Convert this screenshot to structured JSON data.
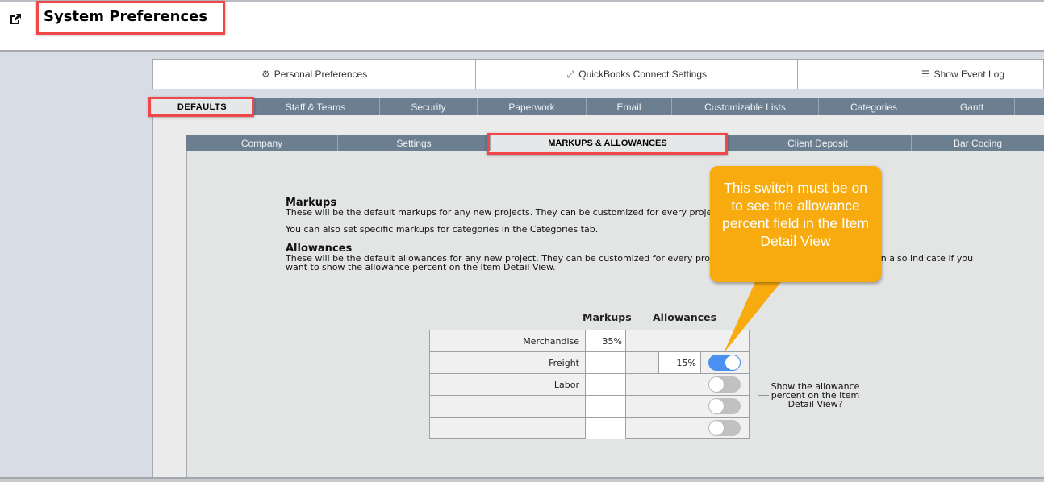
{
  "window": {
    "title": "System Preferences",
    "open_external_icon": "external-link-icon"
  },
  "top_links": [
    {
      "label": "Personal Preferences",
      "icon": "gear-icon"
    },
    {
      "label": "QuickBooks Connect Settings",
      "icon": "expand-arrows-icon"
    },
    {
      "label": "Show Event Log",
      "icon": "list-icon"
    }
  ],
  "main_tabs": [
    {
      "label": "DEFAULTS",
      "active": true
    },
    {
      "label": "Staff & Teams"
    },
    {
      "label": "Security"
    },
    {
      "label": "Paperwork"
    },
    {
      "label": "Email"
    },
    {
      "label": "Customizable Lists"
    },
    {
      "label": "Categories"
    },
    {
      "label": "Gantt"
    },
    {
      "label": ""
    }
  ],
  "sub_tabs": [
    {
      "label": "Company"
    },
    {
      "label": "Settings"
    },
    {
      "label": "MARKUPS & ALLOWANCES",
      "active": true
    },
    {
      "label": "Client Deposit"
    },
    {
      "label": "Bar Coding"
    }
  ],
  "markups_section": {
    "heading": "Markups",
    "line1": "These will be the default markups for any new projects. They can be customized for every proje",
    "line2": "You can also set specific markups for categories in the Categories tab."
  },
  "allowances_section": {
    "heading": "Allowances",
    "line1_a": "These will be the default allowances for any new project. They can be customized for every proj",
    "line1_b": "can also indicate if you",
    "line2": "want to show the allowance percent on the Item Detail View."
  },
  "table": {
    "col_markups": "Markups",
    "col_allowances": "Allowances",
    "rows": [
      {
        "label": "Merchandise",
        "markup": "35%",
        "allowance": null,
        "toggle": null
      },
      {
        "label": "Freight",
        "markup": "",
        "allowance": "15%",
        "toggle": true
      },
      {
        "label": "Labor",
        "markup": "",
        "allowance": null,
        "toggle": false
      },
      {
        "label": "",
        "markup": "",
        "allowance": null,
        "toggle": false
      },
      {
        "label": "",
        "markup": "",
        "allowance": null,
        "toggle": false
      }
    ]
  },
  "toggle_help": "Show the allowance percent on the Item Detail View?",
  "callout": {
    "text": "This switch must be on to see the allowance percent field in the Item Detail View",
    "color": "#f7ab0e"
  },
  "colors": {
    "tab_bar": "#6b7f90",
    "highlight": "#f0474a",
    "toggle_on": "#4a90f0",
    "toggle_off": "#c1c1c1"
  }
}
